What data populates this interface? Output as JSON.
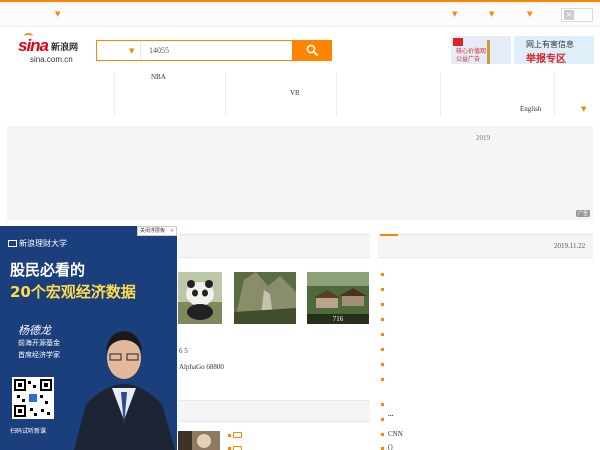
{
  "top_bar": {
    "accent": "#ff8400",
    "chevrons": [
      "chevron-down-icon",
      "chevron-down-icon",
      "chevron-down-icon",
      "chevron-down-icon"
    ],
    "close_icon": "close-icon"
  },
  "logo": {
    "brand": "sina",
    "brand_cn": "新浪网",
    "domain": "sina.com.cn"
  },
  "search": {
    "category": "",
    "query": "14055",
    "button_icon": "search-icon"
  },
  "header_ads": {
    "left_line1": "核心价值观",
    "left_line2": "公益广告",
    "right_line1": "网上有害信息",
    "right_line2": "举报专区"
  },
  "nav": {
    "labels": [
      "NBA",
      "VR",
      "English"
    ]
  },
  "banner": {
    "year": "2019",
    "ad_tag": "广告"
  },
  "float_ad": {
    "close_label": "关闭浮层板",
    "close_icon": "×",
    "header": "新浪理财大学",
    "headline1": "股民必看的",
    "headline2": "20个宏观经济数据",
    "signature": "杨德龙",
    "role1": "前海开源基金",
    "role2": "首席经济学家",
    "qr_caption": "扫码试听新课"
  },
  "main": {
    "right_date": "2019.11.22",
    "photo_caption": "716",
    "text_line1": "6 5",
    "text_line2": "AlphaGo 68800"
  },
  "right_column": {
    "ellipsis": "...",
    "cnn": "CNN",
    "last": "()"
  }
}
